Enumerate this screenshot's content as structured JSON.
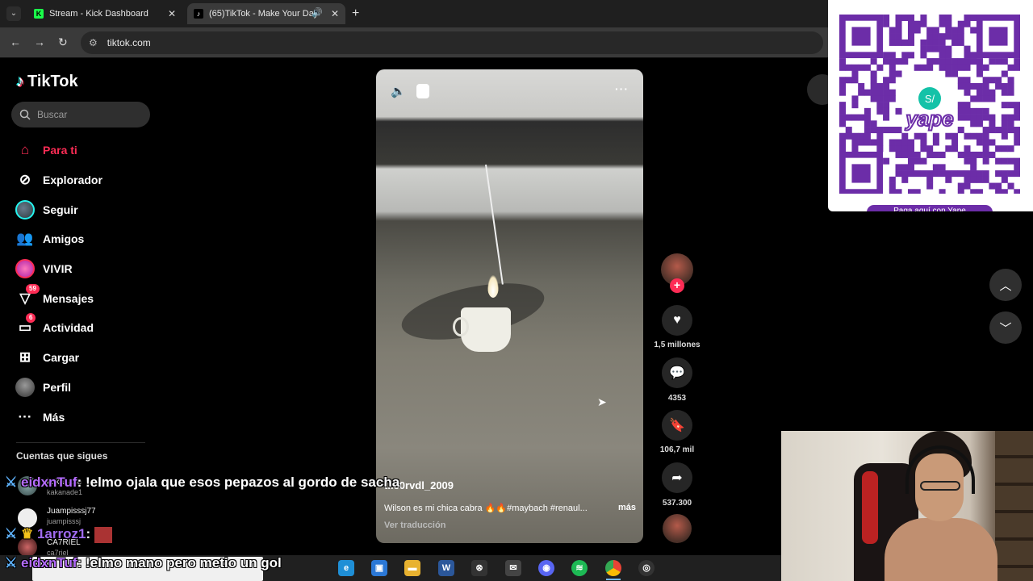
{
  "browser": {
    "tabs": [
      {
        "title": "Stream - Kick Dashboard",
        "favicon": "kick-icon",
        "active": false
      },
      {
        "title": "(65)TikTok - Make Your Day",
        "favicon": "tiktok-icon",
        "active": true,
        "audio": true
      }
    ],
    "url": "tiktok.com"
  },
  "sidebar": {
    "logo_text": "TikTok",
    "search_placeholder": "Buscar",
    "nav": [
      {
        "label": "Para ti",
        "icon": "home-icon",
        "active": true
      },
      {
        "label": "Explorador",
        "icon": "compass-icon"
      },
      {
        "label": "Seguir",
        "icon": "following-avatar-icon"
      },
      {
        "label": "Amigos",
        "icon": "friends-icon"
      },
      {
        "label": "VIVIR",
        "icon": "live-avatar-icon"
      },
      {
        "label": "Mensajes",
        "icon": "messages-icon",
        "badge": "59"
      },
      {
        "label": "Actividad",
        "icon": "activity-icon",
        "badge": "6"
      },
      {
        "label": "Cargar",
        "icon": "upload-icon"
      },
      {
        "label": "Perfil",
        "icon": "profile-avatar-icon"
      },
      {
        "label": "Más",
        "icon": "more-icon"
      }
    ],
    "following_title": "Cuentas que sigues",
    "accounts": [
      {
        "name": "kakanade",
        "handle": "kakanade1"
      },
      {
        "name": "Juampisssj77",
        "handle": "juampisssj"
      },
      {
        "name": "CA7RIEL",
        "handle": "ca7riel"
      }
    ]
  },
  "video": {
    "author": "t..c0rvdl_2009",
    "caption": "Wilson es mi chica cabra 🔥🔥#maybach #renaul...",
    "more_label": "más",
    "translate_label": "Ver traducción"
  },
  "actions": {
    "likes": "1,5 millones",
    "comments": "4353",
    "saves": "106,7 mil",
    "shares": "537.300"
  },
  "overlay": {
    "qr_caption": "Paga aquí con Yape",
    "qr_brand": "yape",
    "qr_symbol": "S/"
  },
  "chat": [
    {
      "user": "eidxnTuf",
      "message": "!elmo ojala que esos pepazos al gordo de sacha"
    },
    {
      "user": "1arroz1",
      "message": ""
    },
    {
      "user": "eidxnTuf",
      "message": "!elmo mano pero metio un gol"
    }
  ],
  "colors": {
    "accent": "#fe2c55",
    "yape_purple": "#6c2da8",
    "chat_user": "#b56cff"
  }
}
